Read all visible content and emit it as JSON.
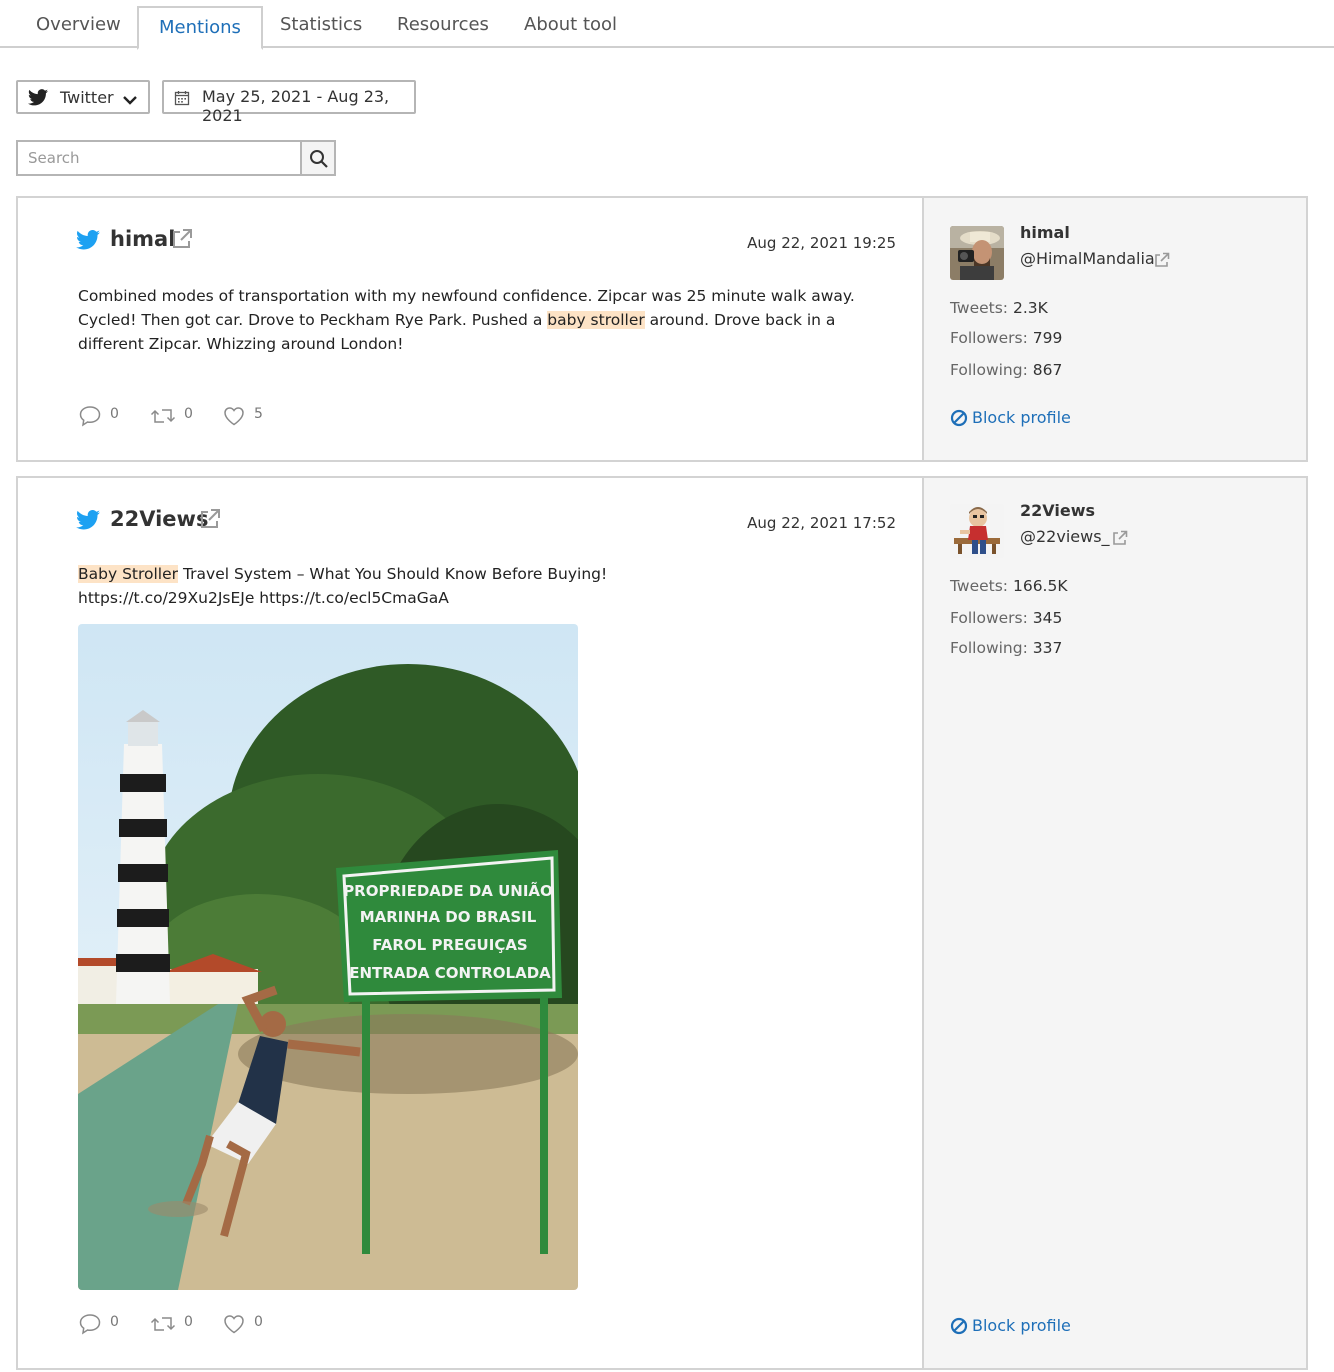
{
  "tabs": [
    {
      "label": "Overview"
    },
    {
      "label": "Mentions"
    },
    {
      "label": "Statistics"
    },
    {
      "label": "Resources"
    },
    {
      "label": "About tool"
    }
  ],
  "active_tab": "Mentions",
  "filters": {
    "platform": "Twitter",
    "date_range": "May 25, 2021 - Aug 23, 2021",
    "search_placeholder": "Search"
  },
  "accent_color": "#1e6fb8",
  "twitter_color": "#1da1f2",
  "highlight_color": "#fde3c6",
  "mentions": [
    {
      "author": "himal",
      "date": "Aug 22, 2021 19:25",
      "text_before": "Combined modes of transportation with my newfound confidence. Zipcar was 25 minute walk away. Cycled! Then got car. Drove to Peckham Rye Park. Pushed a ",
      "text_highlight": "baby stroller",
      "text_after": " around. Drove back in a different Zipcar. Whizzing around London!",
      "replies": "0",
      "retweets": "0",
      "likes": "5",
      "profile": {
        "name": "himal",
        "handle": "@HimalMandalia",
        "tweets_label": "Tweets:",
        "tweets": "2.3K",
        "followers_label": "Followers:",
        "followers": "799",
        "following_label": "Following:",
        "following": "867",
        "block_label": "Block profile"
      }
    },
    {
      "author": "22Views",
      "date": "Aug 22, 2021 17:52",
      "text_highlight": "Baby Stroller",
      "text_after": " Travel System – What You Should Know Before Buying! https://t.co/29Xu2JsEJe https://t.co/ecl5CmaGaA",
      "image_sign": [
        "PROPRIEDADE DA UNIÃO",
        "MARINHA DO BRASIL",
        "FAROL PREGUIÇAS",
        "ENTRADA CONTROLADA"
      ],
      "replies": "0",
      "retweets": "0",
      "likes": "0",
      "profile": {
        "name": "22Views",
        "handle": "@22views_",
        "tweets_label": "Tweets:",
        "tweets": "166.5K",
        "followers_label": "Followers:",
        "followers": "345",
        "following_label": "Following:",
        "following": "337",
        "block_label": "Block profile"
      }
    }
  ]
}
